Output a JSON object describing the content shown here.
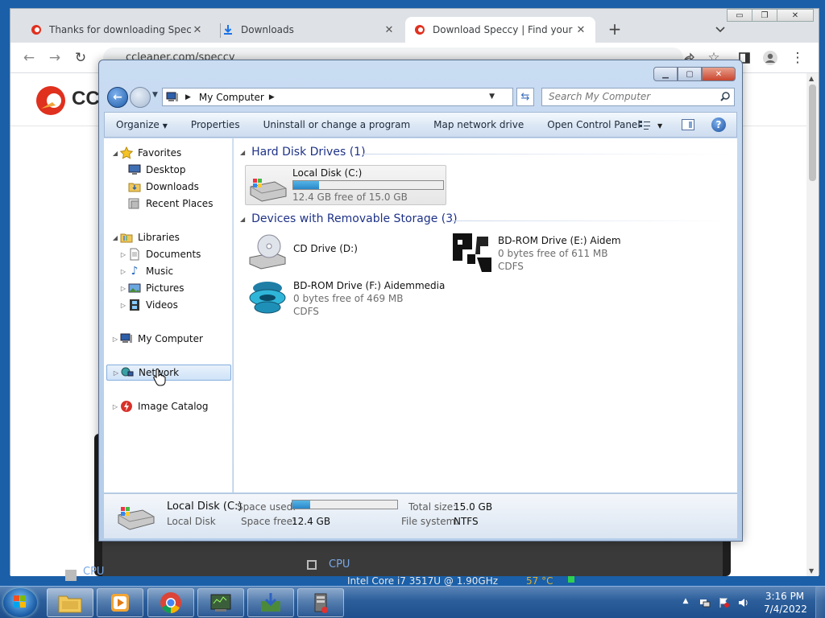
{
  "browser": {
    "tabs": [
      {
        "title": "Thanks for downloading Speccy"
      },
      {
        "title": "Downloads"
      },
      {
        "title": "Download Speccy | Find your co"
      }
    ],
    "address": "ccleaner.com/speccy",
    "window_controls": {
      "minimize": "▭",
      "restore": "❐",
      "close": "✕"
    }
  },
  "webpage": {
    "logo_text": "CCl",
    "speccy_preview": {
      "cpu_label_left": "CPU",
      "cpu_label_right": "CPU",
      "cpu_model": "Intel Core i7 3517U @ 1.90GHz",
      "cpu_temp": "57 °C"
    }
  },
  "explorer": {
    "breadcrumb": "My Computer",
    "search_placeholder": "Search My Computer",
    "commands": [
      "Organize",
      "Properties",
      "Uninstall or change a program",
      "Map network drive",
      "Open Control Panel"
    ],
    "nav": {
      "favorites": "Favorites",
      "desktop": "Desktop",
      "downloads": "Downloads",
      "recent": "Recent Places",
      "libraries": "Libraries",
      "documents": "Documents",
      "music": "Music",
      "pictures": "Pictures",
      "videos": "Videos",
      "computer": "My Computer",
      "network": "Network",
      "catalog": "Image Catalog"
    },
    "groups": {
      "hdd": "Hard Disk Drives (1)",
      "removable": "Devices with Removable Storage (3)"
    },
    "drives": {
      "c": {
        "name": "Local Disk (C:)",
        "free": "12.4 GB free of 15.0 GB",
        "used_fraction": 0.173
      },
      "d": {
        "name": "CD Drive (D:)"
      },
      "e": {
        "name": "BD-ROM Drive (E:) Aidem",
        "free": "0 bytes free of 611 MB",
        "fs": "CDFS"
      },
      "f": {
        "name": "BD-ROM Drive (F:) Aidemmedia",
        "free": "0 bytes free of 469 MB",
        "fs": "CDFS"
      }
    },
    "details": {
      "name": "Local Disk (C:)",
      "type": "Local Disk",
      "space_used_label": "Space used:",
      "space_free_label": "Space free:",
      "space_free": "12.4 GB",
      "total_label": "Total size:",
      "total": "15.0 GB",
      "fs_label": "File system:",
      "fs": "NTFS",
      "used_fraction": 0.173
    }
  },
  "taskbar": {
    "time": "3:16 PM",
    "date": "7/4/2022"
  }
}
